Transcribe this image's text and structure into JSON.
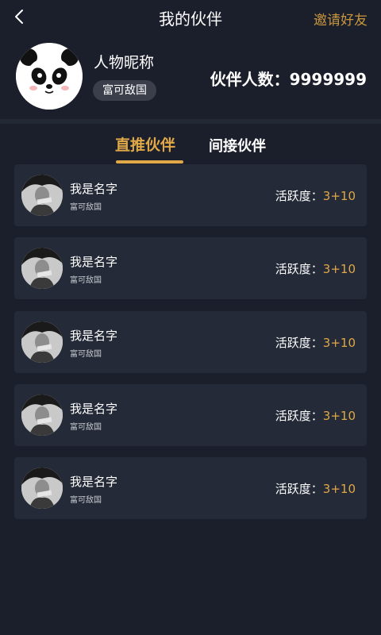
{
  "nav": {
    "title": "我的伙伴",
    "invite_label": "邀请好友"
  },
  "profile": {
    "nickname": "人物昵称",
    "level": "富可敌国",
    "partner_count_text": "伙伴人数：9999999"
  },
  "tabs": [
    {
      "label": "直推伙伴",
      "active": true
    },
    {
      "label": "间接伙伴",
      "active": false
    }
  ],
  "partners": [
    {
      "name": "我是名字",
      "level": "富可敌国",
      "activity_label": "活跃度：",
      "activity_value": "3+10"
    },
    {
      "name": "我是名字",
      "level": "富可敌国",
      "activity_label": "活跃度：",
      "activity_value": "3+10"
    },
    {
      "name": "我是名字",
      "level": "富可敌国",
      "activity_label": "活跃度：",
      "activity_value": "3+10"
    },
    {
      "name": "我是名字",
      "level": "富可敌国",
      "activity_label": "活跃度：",
      "activity_value": "3+10"
    },
    {
      "name": "我是名字",
      "level": "富可敌国",
      "activity_label": "活跃度：",
      "activity_value": "3+10"
    }
  ],
  "colors": {
    "background": "#1b1f2b",
    "card": "#242a37",
    "accent": "#e0a847",
    "invite": "#c8963e"
  },
  "icons": {
    "back": "chevron-left-icon",
    "profile_avatar": "panda-avatar-icon",
    "partner_avatar": "person-photo-avatar"
  }
}
